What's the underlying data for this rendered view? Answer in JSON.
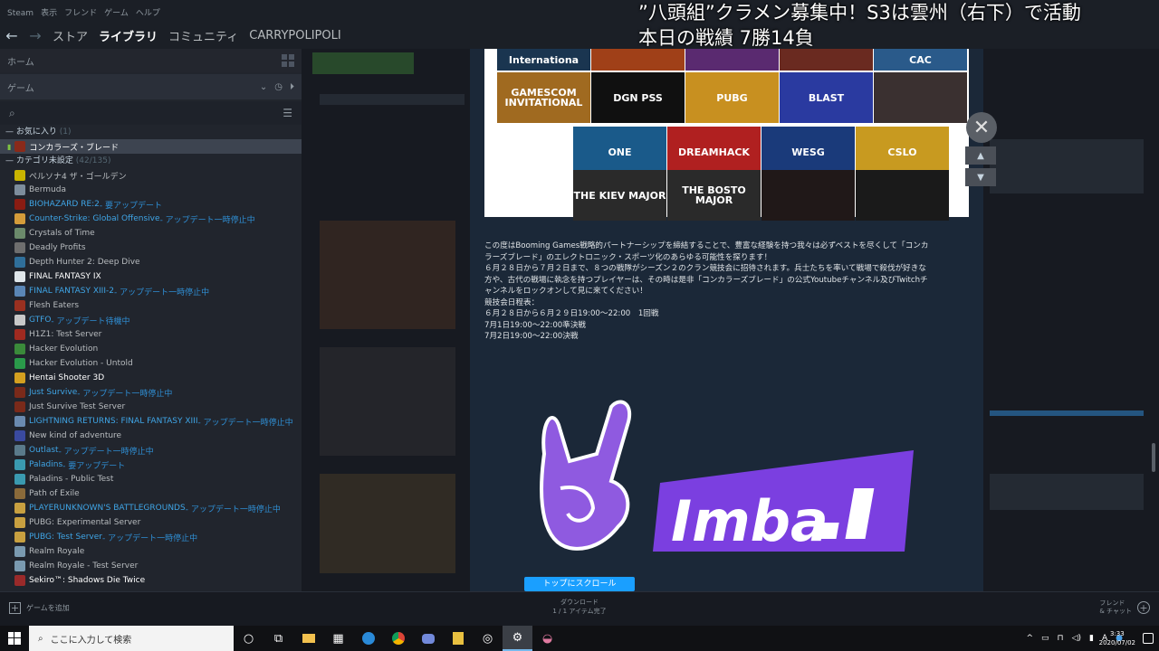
{
  "menubar": [
    "Steam",
    "表示",
    "フレンド",
    "ゲーム",
    "ヘルプ"
  ],
  "nav": {
    "back": "←",
    "forward": "→",
    "tabs": [
      "ストア",
      "ライブラリ",
      "コミュニティ",
      "CARRYPOLIPOLI"
    ]
  },
  "sidebar": {
    "home_label": "ホーム",
    "filter_label": "ゲーム",
    "fav_category": "お気に入り",
    "fav_count": "(1)",
    "uncat_category": "カテゴリ未設定",
    "uncat_count": "(42/135)",
    "selected_game": "コンカラーズ・ブレード",
    "games": [
      {
        "name": "ペルソナ4 ザ・ゴールデン",
        "status": "",
        "color": "#c9b400",
        "style": ""
      },
      {
        "name": "Bermuda",
        "status": "",
        "color": "#7d8d9c",
        "style": ""
      },
      {
        "name": "BIOHAZARD RE:2",
        "status": " - 要アップデート",
        "color": "#8a1c12",
        "style": "blue"
      },
      {
        "name": "Counter-Strike: Global Offensive",
        "status": " - アップデート一時停止中",
        "color": "#d49c3a",
        "style": "blue"
      },
      {
        "name": "Crystals of Time",
        "status": "",
        "color": "#6b8a6b",
        "style": ""
      },
      {
        "name": "Deadly Profits",
        "status": "",
        "color": "#6e6e6e",
        "style": ""
      },
      {
        "name": "Depth Hunter 2: Deep Dive",
        "status": "",
        "color": "#2f6f9a",
        "style": ""
      },
      {
        "name": "FINAL FANTASY IX",
        "status": "",
        "color": "#dfe6ea",
        "style": "white"
      },
      {
        "name": "FINAL FANTASY XIII-2",
        "status": " - アップデート一時停止中",
        "color": "#5a86b6",
        "style": "blue"
      },
      {
        "name": "Flesh Eaters",
        "status": "",
        "color": "#9a3020",
        "style": ""
      },
      {
        "name": "GTFO",
        "status": " - アップデート待機中",
        "color": "#c8c8c8",
        "style": "blue"
      },
      {
        "name": "H1Z1: Test Server",
        "status": "",
        "color": "#a02a20",
        "style": ""
      },
      {
        "name": "Hacker Evolution",
        "status": "",
        "color": "#3a8a3a",
        "style": ""
      },
      {
        "name": "Hacker Evolution - Untold",
        "status": "",
        "color": "#2a9a4a",
        "style": ""
      },
      {
        "name": "Hentai Shooter 3D",
        "status": "",
        "color": "#d4a020",
        "style": "white"
      },
      {
        "name": "Just Survive",
        "status": " - アップデート一時停止中",
        "color": "#7a2a1a",
        "style": "blue"
      },
      {
        "name": "Just Survive Test Server",
        "status": "",
        "color": "#7a2a1a",
        "style": ""
      },
      {
        "name": "LIGHTNING RETURNS: FINAL FANTASY XIII",
        "status": " - アップデート一時停止中",
        "color": "#6a8ab0",
        "style": "blue"
      },
      {
        "name": "New kind of adventure",
        "status": "",
        "color": "#3a4aa0",
        "style": ""
      },
      {
        "name": "Outlast",
        "status": " - アップデート一時停止中",
        "color": "#5a7a8a",
        "style": "blue"
      },
      {
        "name": "Paladins",
        "status": " - 要アップデート",
        "color": "#3a9ab0",
        "style": "blue"
      },
      {
        "name": "Paladins - Public Test",
        "status": "",
        "color": "#3a9ab0",
        "style": ""
      },
      {
        "name": "Path of Exile",
        "status": "",
        "color": "#8a6a3a",
        "style": ""
      },
      {
        "name": "PLAYERUNKNOWN'S BATTLEGROUNDS",
        "status": " - アップデート一時停止中",
        "color": "#c8a040",
        "style": "blue"
      },
      {
        "name": "PUBG: Experimental Server",
        "status": "",
        "color": "#c8a040",
        "style": ""
      },
      {
        "name": "PUBG: Test Server",
        "status": " - アップデート一時停止中",
        "color": "#c8a040",
        "style": "blue"
      },
      {
        "name": "Realm Royale",
        "status": "",
        "color": "#7a9ab0",
        "style": ""
      },
      {
        "name": "Realm Royale - Test Server",
        "status": "",
        "color": "#7a9ab0",
        "style": ""
      },
      {
        "name": "Sekiro™: Shadows Die Twice",
        "status": "",
        "color": "#9a2a2a",
        "style": "white"
      }
    ]
  },
  "bottombar": {
    "add_game": "ゲームを追加",
    "download_title": "ダウンロード",
    "download_sub": "1 / 1 アイテム完了",
    "friends_line1": "フレンド",
    "friends_line2": "& チャット"
  },
  "overlay": {
    "line1": "”八頭組”クラメン募集中！S3は雲州（右下）で活動",
    "line2": "本日の戦績 7勝14負"
  },
  "modal": {
    "logos": [
      {
        "t": "Internationa",
        "bg": "#1a3550"
      },
      {
        "t": "",
        "bg": "#a04018"
      },
      {
        "t": "",
        "bg": "#5a2a70"
      },
      {
        "t": "",
        "bg": "#6a2a20"
      },
      {
        "t": "CAC",
        "bg": "#2a5a8a"
      },
      {
        "t": "GAMESCOM INVITATIONAL",
        "bg": "#a06a20"
      },
      {
        "t": "DGN PSS",
        "bg": "#101010"
      },
      {
        "t": "PUBG",
        "bg": "#c89020"
      },
      {
        "t": "BLAST",
        "bg": "#2a3aa0"
      },
      {
        "t": "",
        "bg": "#3a3030"
      },
      {
        "t": "ONE",
        "bg": "#1a5a8a"
      },
      {
        "t": "DREAMHACK",
        "bg": "#b02020"
      },
      {
        "t": "WESG",
        "bg": "#1a3a7a"
      },
      {
        "t": "CSLO",
        "bg": "#c89a20"
      },
      {
        "t": "THE KIEV MAJOR",
        "bg": "#2a2a2a"
      },
      {
        "t": "THE BOSTO MAJOR",
        "bg": "#2a2a2a"
      },
      {
        "t": "",
        "bg": "#201818"
      },
      {
        "t": "",
        "bg": "#1a1a1a"
      }
    ],
    "desc": [
      "この度はBooming Games戦略的パートナーシップを締結することで、豊富な経験を持つ我々は必ずベストを尽くして「コンカ",
      "ラーズブレード」のエレクトロニック・スポーツ化のあらゆる可能性を探ります！",
      "６月２８日から７月２日まで、８つの戦隊がシーズン２のクラン競技会に招待されます。兵士たちを率いて戦場で殺伐が好きな",
      "方や、古代の戦場に執念を持つプレイヤーは、その時は是非「コンカラーズブレード」の公式Youtubeチャンネル及びTwitchチ",
      "ャンネルをロックオンして見に来てください！",
      "競技会日程表：",
      "６月２８日から６月２９日19:00～22:00　1回戦",
      "7月1日19:00～22:00準決戦",
      "7月2日19:00～22:00決戦"
    ],
    "imba_text": "Imba",
    "scroll_top": "トップにスクロール"
  },
  "taskbar": {
    "search_placeholder": "ここに入力して検索",
    "time": "3:33",
    "date": "2020/07/02",
    "tray_a": "A"
  }
}
